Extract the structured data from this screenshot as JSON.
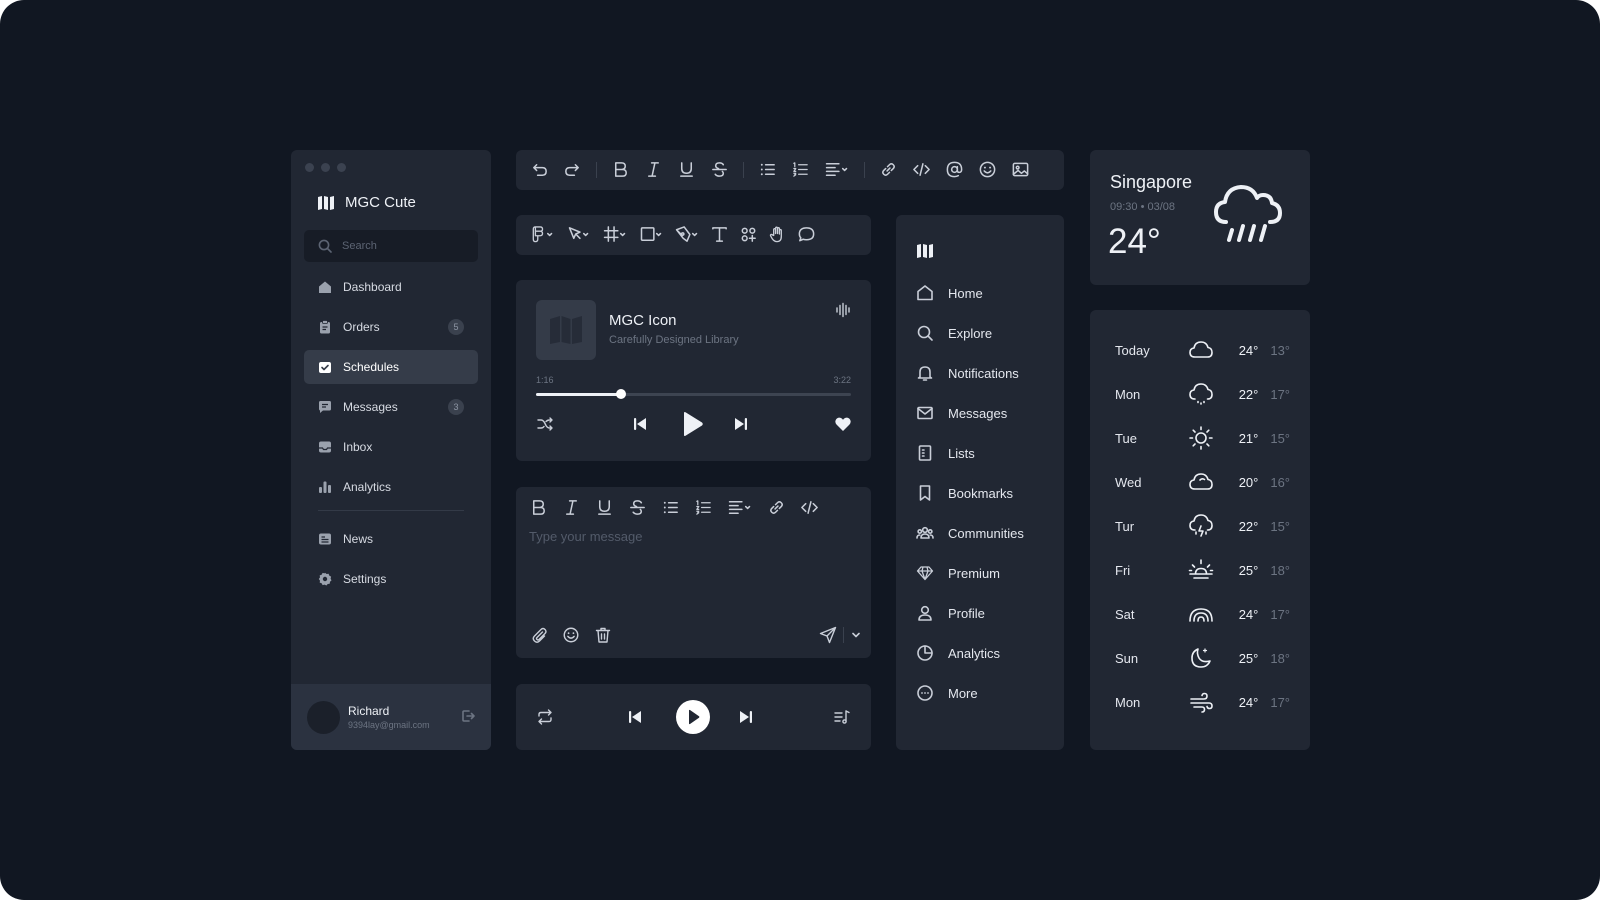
{
  "sidebar": {
    "brand": "MGC Cute",
    "search_placeholder": "Search",
    "items": [
      {
        "label": "Dashboard",
        "icon": "home-icon",
        "badge": ""
      },
      {
        "label": "Orders",
        "icon": "clipboard-icon",
        "badge": "5"
      },
      {
        "label": "Schedules",
        "icon": "check-calendar-icon",
        "badge": ""
      },
      {
        "label": "Messages",
        "icon": "chat-icon",
        "badge": "3"
      },
      {
        "label": "Inbox",
        "icon": "inbox-icon",
        "badge": ""
      },
      {
        "label": "Analytics",
        "icon": "bar-chart-icon",
        "badge": ""
      },
      {
        "label": "News",
        "icon": "news-icon",
        "badge": ""
      },
      {
        "label": "Settings",
        "icon": "gear-icon",
        "badge": ""
      }
    ],
    "active": "Schedules",
    "user": {
      "name": "Richard",
      "email": "9394lay@gmail.com"
    }
  },
  "music": {
    "title": "MGC Icon",
    "subtitle": "Carefully Designed Library",
    "elapsed": "1:16",
    "duration": "3:22",
    "progress": 0.27
  },
  "editor": {
    "placeholder": "Type your message"
  },
  "menu": {
    "items": [
      {
        "label": "Home",
        "icon": "home-outline-icon"
      },
      {
        "label": "Explore",
        "icon": "search-icon"
      },
      {
        "label": "Notifications",
        "icon": "bell-icon"
      },
      {
        "label": "Messages",
        "icon": "mail-icon"
      },
      {
        "label": "Lists",
        "icon": "list-doc-icon"
      },
      {
        "label": "Bookmarks",
        "icon": "bookmark-icon"
      },
      {
        "label": "Communities",
        "icon": "people-icon"
      },
      {
        "label": "Premium",
        "icon": "diamond-icon"
      },
      {
        "label": "Profile",
        "icon": "user-icon"
      },
      {
        "label": "Analytics",
        "icon": "pie-chart-icon"
      },
      {
        "label": "More",
        "icon": "more-circle-icon"
      }
    ]
  },
  "weather": {
    "city": "Singapore",
    "datetime": "09:30 • 03/08",
    "temp": "24°",
    "current_icon": "rain-cloud-icon",
    "forecast": [
      {
        "day": "Today",
        "icon": "cloud-icon",
        "hi": "24°",
        "lo": "13°"
      },
      {
        "day": "Mon",
        "icon": "drizzle-icon",
        "hi": "22°",
        "lo": "17°"
      },
      {
        "day": "Tue",
        "icon": "sun-icon",
        "hi": "21°",
        "lo": "15°"
      },
      {
        "day": "Wed",
        "icon": "cloud-icon",
        "hi": "20°",
        "lo": "16°"
      },
      {
        "day": "Tur",
        "icon": "thunderstorm-icon",
        "hi": "22°",
        "lo": "15°"
      },
      {
        "day": "Fri",
        "icon": "sunrise-icon",
        "hi": "25°",
        "lo": "18°"
      },
      {
        "day": "Sat",
        "icon": "rainbow-icon",
        "hi": "24°",
        "lo": "17°"
      },
      {
        "day": "Sun",
        "icon": "moon-icon",
        "hi": "25°",
        "lo": "18°"
      },
      {
        "day": "Mon",
        "icon": "wind-icon",
        "hi": "24°",
        "lo": "17°"
      }
    ]
  },
  "colors": {
    "background": "#111722",
    "panel": "#212733",
    "active_item": "#353c49",
    "text": "#eef1f6",
    "muted": "#6c7482"
  }
}
